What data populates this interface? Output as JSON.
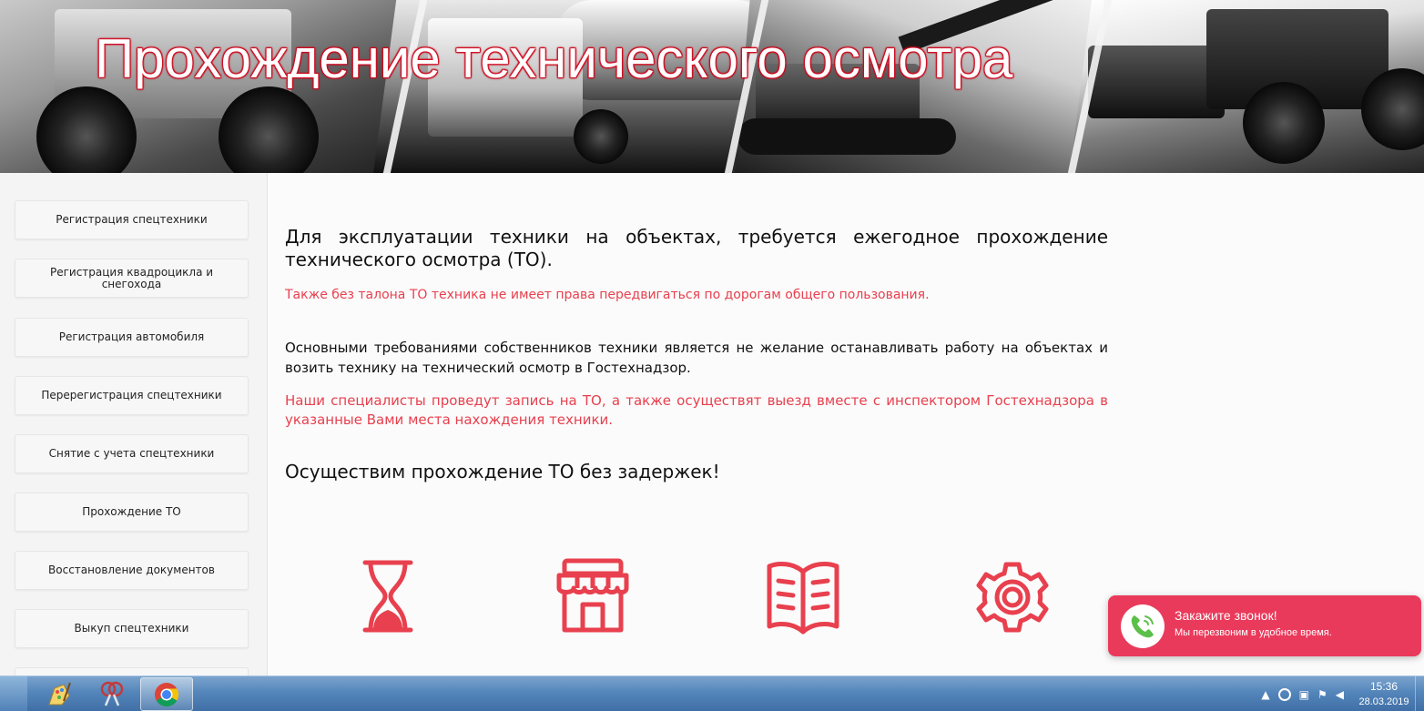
{
  "banner": {
    "title": "Прохождение технического осмотра"
  },
  "sidebar": {
    "items": [
      {
        "label": "Регистрация спецтехники"
      },
      {
        "label": "Регистрация квадроцикла и снегохода"
      },
      {
        "label": "Регистрация автомобиля"
      },
      {
        "label": "Перерегистрация спецтехники"
      },
      {
        "label": "Снятие с учета спецтехники"
      },
      {
        "label": "Прохождение ТО"
      },
      {
        "label": "Восстановление документов"
      },
      {
        "label": "Выкуп спецтехники"
      }
    ]
  },
  "main": {
    "heading": "Для эксплуатации техники на объектах, требуется ежегодное прохождение технического осмотра (ТО).",
    "note1": "Также без талона ТО техника не имеет права передвигаться по дорогам общего пользования.",
    "paragraph": "Основными требованиями собственников техники является не желание останавливать работу на объектах и возить технику на технический осмотр в Гостехнадзор.",
    "note2": "Наши специалисты проведут запись на ТО, а также осуществят выезд вместе с инспектором Гостехнадзора в указанные Вами места нахождения техники.",
    "subheading": "Осуществим прохождение ТО без задержек!",
    "features": [
      {
        "icon": "hourglass-icon"
      },
      {
        "icon": "store-icon"
      },
      {
        "icon": "book-icon"
      },
      {
        "icon": "gear-icon"
      }
    ]
  },
  "callback": {
    "title": "Закажите звонок!",
    "subtitle": "Мы перезвоним в удобное время.",
    "icon": "phone-icon"
  },
  "taskbar": {
    "time": "15:36",
    "date": "28.03.2019",
    "apps": [
      "paint-icon",
      "snipping-tool-icon",
      "chrome-icon"
    ]
  },
  "colors": {
    "accent": "#e8404e",
    "callback_bg": "#ea3a5b",
    "banner_title_glow": "#e3142c"
  }
}
